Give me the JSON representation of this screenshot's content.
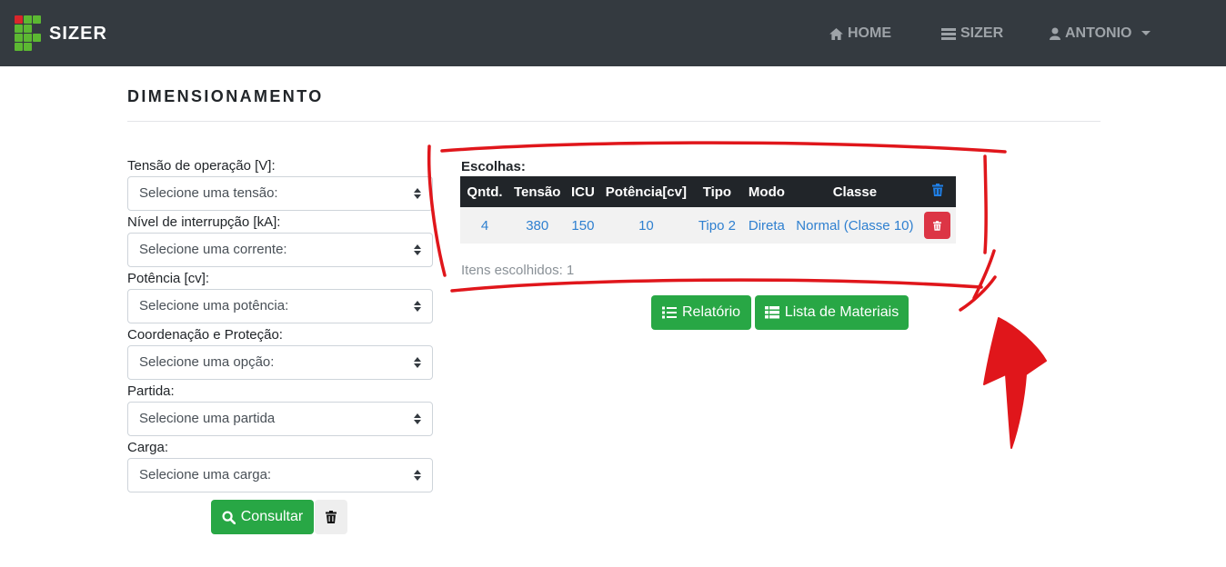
{
  "navbar": {
    "brand": "SIZER",
    "links": [
      {
        "label": "HOME",
        "icon": "home-icon"
      },
      {
        "label": "SIZER",
        "icon": "list-icon"
      },
      {
        "label": "ANTONIO",
        "icon": "user-icon"
      }
    ]
  },
  "page": {
    "title": "DIMENSIONAMENTO"
  },
  "form": {
    "fields": [
      {
        "label": "Tensão de operação [V]:",
        "value": "Selecione uma tensão:"
      },
      {
        "label": "Nível de interrupção [kA]:",
        "value": "Selecione uma corrente:"
      },
      {
        "label": "Potência [cv]:",
        "value": "Selecione uma potência:"
      },
      {
        "label": "Coordenação e Proteção:",
        "value": "Selecione uma opção:"
      },
      {
        "label": "Partida:",
        "value": "Selecione uma partida"
      },
      {
        "label": "Carga:",
        "value": "Selecione uma carga:"
      }
    ],
    "consultar_label": "Consultar"
  },
  "choices": {
    "label": "Escolhas:",
    "headers": [
      "Qntd.",
      "Tensão",
      "ICU",
      "Potência[cv]",
      "Tipo",
      "Modo",
      "Classe"
    ],
    "rows": [
      [
        "4",
        "380",
        "150",
        "10",
        "Tipo 2",
        "Direta",
        "Normal (Classe 10)"
      ]
    ],
    "count_text": "Itens escolhidos: 1"
  },
  "actions": {
    "relatorio_label": "Relatório",
    "lista_label": "Lista de Materiais"
  },
  "colors": {
    "navbar": "#343a40",
    "green": "#28a745",
    "red": "#dc3545",
    "link": "#2f80d0",
    "annotation": "#e0161b"
  }
}
